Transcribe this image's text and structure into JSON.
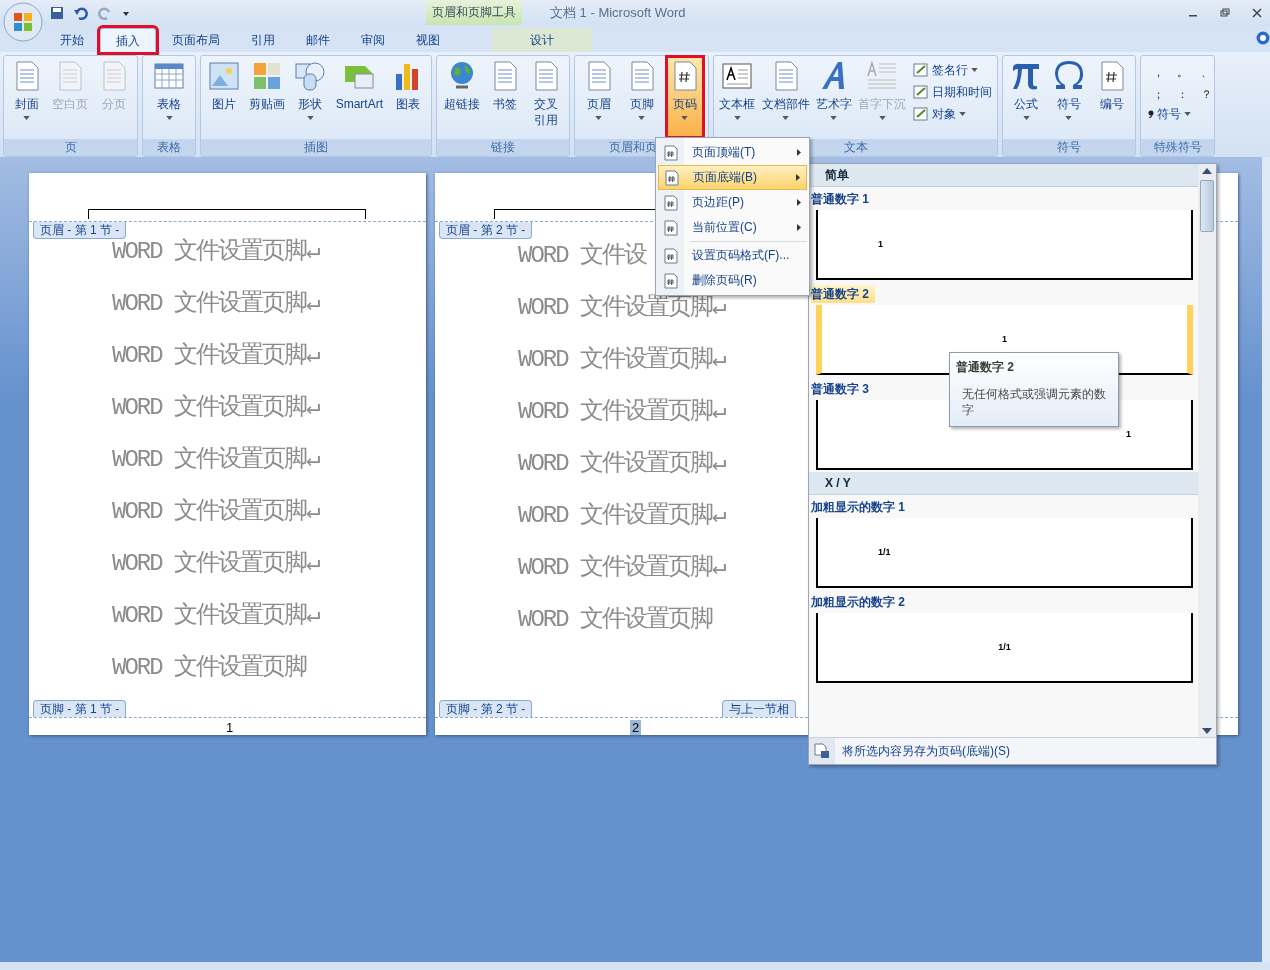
{
  "window": {
    "title": "文档 1 - Microsoft Word",
    "context_tool": "页眉和页脚工具"
  },
  "tabs": [
    {
      "label": "开始",
      "selected": false,
      "highlighted": false
    },
    {
      "label": "插入",
      "selected": true,
      "highlighted": true
    },
    {
      "label": "页面布局",
      "selected": false,
      "highlighted": false
    },
    {
      "label": "引用",
      "selected": false,
      "highlighted": false
    },
    {
      "label": "邮件",
      "selected": false,
      "highlighted": false
    },
    {
      "label": "审阅",
      "selected": false,
      "highlighted": false
    },
    {
      "label": "视图",
      "selected": false,
      "highlighted": false
    },
    {
      "label": "设计",
      "selected": false,
      "highlighted": false,
      "kind": "context"
    }
  ],
  "ribbon": [
    {
      "label": "页",
      "buttons": [
        {
          "label": "封面",
          "disabled": false,
          "dropdown": true
        },
        {
          "label": "空白页",
          "disabled": true,
          "dropdown": false
        },
        {
          "label": "分页",
          "disabled": true,
          "dropdown": false
        }
      ]
    },
    {
      "label": "表格",
      "buttons": [
        {
          "label": "表格",
          "disabled": false,
          "dropdown": true
        }
      ]
    },
    {
      "label": "插图",
      "buttons": [
        {
          "label": "图片",
          "disabled": false,
          "dropdown": false
        },
        {
          "label": "剪贴画",
          "disabled": false,
          "dropdown": false
        },
        {
          "label": "形状",
          "disabled": false,
          "dropdown": true
        },
        {
          "label": "SmartArt",
          "disabled": false,
          "dropdown": false
        },
        {
          "label": "图表",
          "disabled": false,
          "dropdown": false
        }
      ]
    },
    {
      "label": "链接",
      "buttons": [
        {
          "label": "超链接",
          "disabled": false,
          "dropdown": false
        },
        {
          "label": "书签",
          "disabled": false,
          "dropdown": false
        },
        {
          "label": "交叉引用",
          "disabled": false,
          "dropdown": false,
          "wrap": true
        }
      ]
    },
    {
      "label": "页眉和页",
      "buttons": [
        {
          "label": "页眉",
          "disabled": false,
          "dropdown": true
        },
        {
          "label": "页脚",
          "disabled": false,
          "dropdown": true
        },
        {
          "label": "页码",
          "disabled": false,
          "dropdown": true,
          "highlighted": true
        }
      ]
    },
    {
      "label": "文本",
      "buttons": [
        {
          "label": "文本框",
          "disabled": false,
          "dropdown": true
        },
        {
          "label": "文档部件",
          "disabled": false,
          "dropdown": true
        },
        {
          "label": "艺术字",
          "disabled": false,
          "dropdown": true
        },
        {
          "label": "首字下沉",
          "disabled": true,
          "dropdown": true
        }
      ],
      "small": [
        {
          "label": "签名行",
          "dropdown": true
        },
        {
          "label": "日期和时间",
          "dropdown": false
        },
        {
          "label": "对象",
          "dropdown": true
        }
      ]
    },
    {
      "label": "符号",
      "buttons": [
        {
          "label": "公式",
          "disabled": false,
          "dropdown": true
        },
        {
          "label": "符号",
          "disabled": false,
          "dropdown": true
        },
        {
          "label": "编号",
          "disabled": false,
          "dropdown": false
        }
      ]
    },
    {
      "label": "特殊符号",
      "punct": [
        "，",
        "。",
        "、",
        "；",
        "：",
        "？"
      ],
      "more": "符号"
    }
  ],
  "pages": [
    {
      "header_tab": "页眉 - 第 1 节 -",
      "footer_tab": "页脚 - 第 1 节 -",
      "page_number": "1",
      "number_selected": false,
      "lines": [
        "WORD 文件设置页脚↵",
        "WORD 文件设置页脚↵",
        "WORD 文件设置页脚↵",
        "WORD 文件设置页脚↵",
        "WORD 文件设置页脚↵",
        "WORD 文件设置页脚↵",
        "WORD 文件设置页脚↵",
        "WORD 文件设置页脚↵",
        "WORD 文件设置页脚"
      ]
    },
    {
      "header_tab": "页眉 - 第 2 节 -",
      "footer_tab": "页脚 - 第 2 节 -",
      "footer_extra": "与上一节相",
      "page_number": "2",
      "number_selected": true,
      "lines": [
        "WORD 文件设",
        "WORD 文件设置页脚↵",
        "WORD 文件设置页脚↵",
        "WORD 文件设置页脚↵",
        "WORD 文件设置页脚↵",
        "WORD 文件设置页脚↵",
        "WORD 文件设置页脚↵",
        "WORD 文件设置页脚"
      ]
    }
  ],
  "menu": [
    {
      "label": "页面顶端(T)",
      "submenu": true,
      "selected": false
    },
    {
      "label": "页面底端(B)",
      "submenu": true,
      "selected": true
    },
    {
      "label": "页边距(P)",
      "submenu": true,
      "selected": false
    },
    {
      "label": "当前位置(C)",
      "submenu": true,
      "selected": false
    },
    {
      "label": "设置页码格式(F)...",
      "submenu": false,
      "selected": false,
      "separator_before": true
    },
    {
      "label": "删除页码(R)",
      "submenu": false,
      "selected": false
    }
  ],
  "gallery": {
    "sections": [
      {
        "title": "简单",
        "items": [
          {
            "label": "普通数字 1",
            "preview": "1",
            "kind": "left",
            "selected": false
          },
          {
            "label": "普通数字 2",
            "preview": "1",
            "kind": "center",
            "selected": true
          },
          {
            "label": "普通数字 3",
            "preview": "1",
            "kind": "right",
            "selected": false
          }
        ]
      },
      {
        "title": "X / Y",
        "items": [
          {
            "label": "加粗显示的数字 1",
            "preview": "1/1",
            "kind": "left",
            "selected": false
          },
          {
            "label": "加粗显示的数字 2",
            "preview": "1/1",
            "kind": "center",
            "selected": false
          }
        ]
      }
    ],
    "footer": "将所选内容另存为页码(底端)(S)"
  },
  "tooltip": {
    "title": "普通数字 2",
    "text": "无任何格式或强调元素的数字"
  }
}
